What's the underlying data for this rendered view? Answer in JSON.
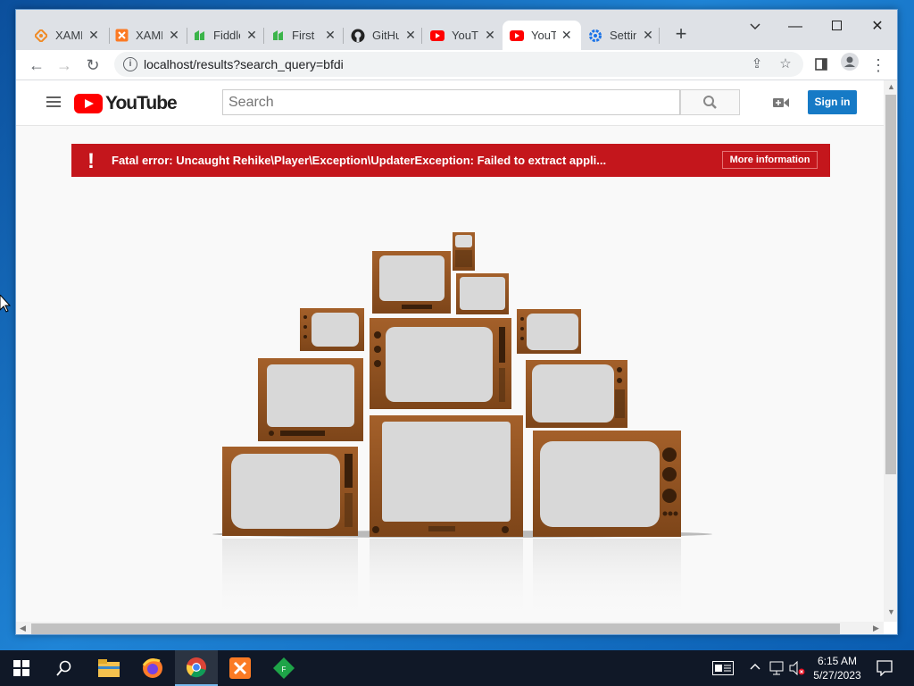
{
  "browser": {
    "tabs": [
      {
        "title": "XAMPP",
        "icon": "xampp-orange-icon",
        "active": false
      },
      {
        "title": "XAMPP",
        "icon": "xampp-icon",
        "active": false
      },
      {
        "title": "Fiddle",
        "icon": "fiddle-icon",
        "active": false
      },
      {
        "title": "First",
        "icon": "first-icon",
        "active": false
      },
      {
        "title": "GitHub",
        "icon": "github-icon",
        "active": false
      },
      {
        "title": "YouTube",
        "icon": "youtube-icon",
        "active": false
      },
      {
        "title": "YouTube",
        "icon": "youtube-icon",
        "active": true
      },
      {
        "title": "Settings",
        "icon": "settings-gear-icon",
        "active": false
      }
    ],
    "url": "localhost/results?search_query=bfdi"
  },
  "youtube": {
    "logo_text": "YouTube",
    "search_placeholder": "Search",
    "signin_label": "Sign in",
    "error_message": "Fatal error: Uncaught Rehike\\Player\\Exception\\UpdaterException: Failed to extract appli...",
    "more_info_label": "More information",
    "brand_color": "#ff0000",
    "error_color": "#c4161c",
    "signin_color": "#167ac6"
  },
  "taskbar": {
    "time": "6:15 AM",
    "date": "5/27/2023",
    "apps": [
      "start-icon",
      "search-icon",
      "file-explorer-icon",
      "firefox-icon",
      "chrome-icon",
      "xampp-icon",
      "fiddle-icon"
    ]
  }
}
